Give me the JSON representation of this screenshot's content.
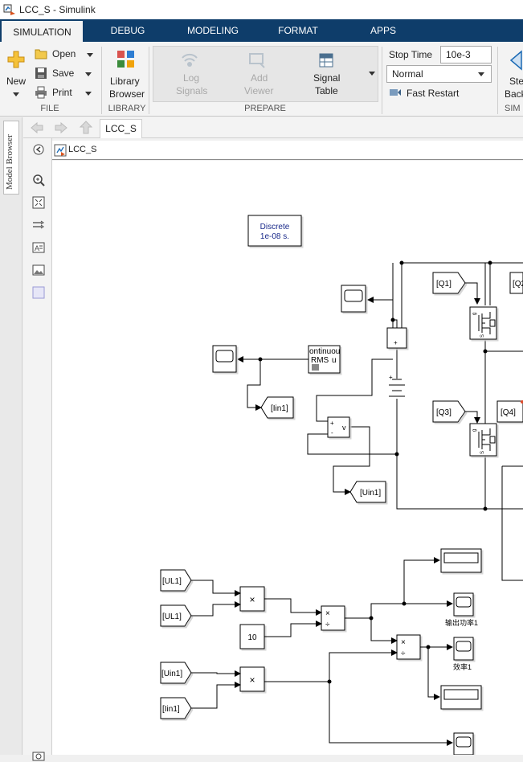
{
  "window": {
    "title": "LCC_S - Simulink"
  },
  "tabs": [
    {
      "label": "SIMULATION"
    },
    {
      "label": "DEBUG"
    },
    {
      "label": "MODELING"
    },
    {
      "label": "FORMAT"
    },
    {
      "label": "APPS"
    }
  ],
  "ribbon": {
    "file": {
      "new_label": "New",
      "open_label": "Open",
      "save_label": "Save",
      "print_label": "Print",
      "group_label": "FILE"
    },
    "library": {
      "label_line1": "Library",
      "label_line2": "Browser",
      "group_label": "LIBRARY"
    },
    "prepare": {
      "log_line1": "Log",
      "log_line2": "Signals",
      "viewer_line1": "Add",
      "viewer_line2": "Viewer",
      "table_line1": "Signal",
      "table_line2": "Table",
      "group_label": "PREPARE"
    },
    "simulate": {
      "stop_time_label": "Stop Time",
      "stop_time_value": "10e-3",
      "mode_value": "Normal",
      "fast_restart_label": "Fast Restart",
      "step_back_line1": "Ste",
      "step_back_line2": "Back",
      "group_label": "SIM"
    }
  },
  "editor": {
    "model_browser_label": "Model Browser",
    "doc_tab": "LCC_S",
    "breadcrumb": "LCC_S"
  },
  "diagram": {
    "powergui_line1": "Discrete",
    "powergui_line2": "1e-08 s.",
    "rms_label_line1": "ontinuou",
    "rms_label_line2": "RMS",
    "rms_u": "u",
    "vm_label": "v",
    "plus": "+",
    "minus": "-",
    "goto_q1": "[Q1]",
    "goto_q2": "[Q2",
    "goto_q3": "[Q3]",
    "goto_q4": "[Q4]",
    "goto_iin1": "[Iin1]",
    "goto_uin1": "[Uin1]",
    "from_ul1_a": "[UL1]",
    "from_ul1_b": "[UL1]",
    "from_uin1": "[Uin1]",
    "from_iin1": "[Iin1]",
    "const_10": "10",
    "mult_symbol": "×",
    "div_symbol": "÷",
    "scope_power_label": "输出功率1",
    "scope_eff_label": "效率1",
    "mosfet_g": "g",
    "mosfet_d": "D",
    "mosfet_s": "S"
  }
}
